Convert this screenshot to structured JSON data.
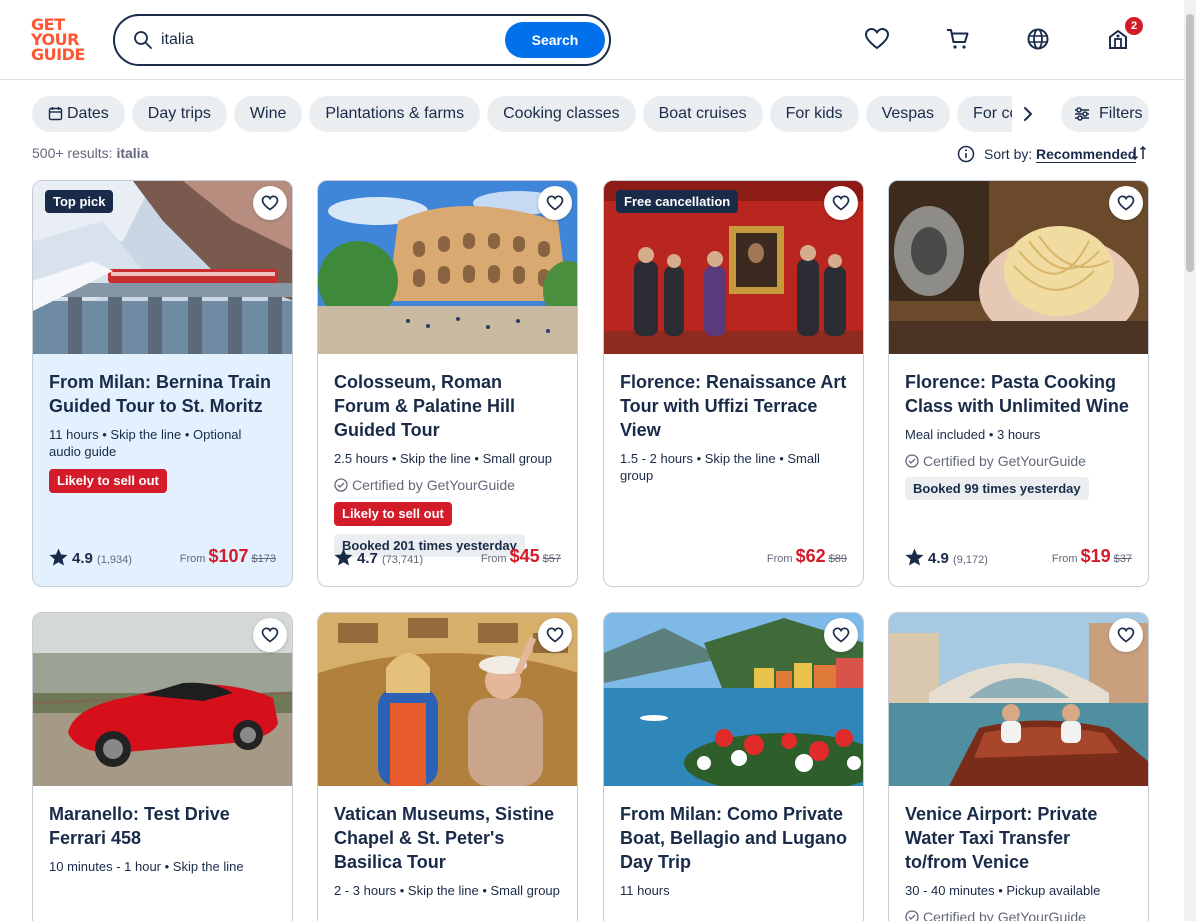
{
  "logo": {
    "line1": "GET",
    "line2": "YOUR",
    "line3": "GUIDE"
  },
  "search": {
    "value": "italia",
    "button": "Search"
  },
  "header": {
    "cart_badge": "2"
  },
  "chips": [
    "Dates",
    "Day trips",
    "Wine",
    "Plantations & farms",
    "Cooking classes",
    "Boat cruises",
    "For kids",
    "Vespas",
    "For couples"
  ],
  "filters_label": "Filters",
  "results": {
    "count": "500+ results:",
    "query": "italia"
  },
  "sort": {
    "label": "Sort by:",
    "value": "Recommended"
  },
  "cards": [
    {
      "tag": "Top pick",
      "title": "From Milan: Bernina Train Guided Tour to St. Moritz",
      "meta": "11 hours • Skip the line • Optional audio guide",
      "sell": "Likely to sell out",
      "rating": "4.9",
      "reviews": "(1,934)",
      "from": "From",
      "price": "$107",
      "old_price": "$173"
    },
    {
      "title": "Colosseum, Roman Forum & Palatine Hill Guided Tour",
      "meta": "2.5 hours • Skip the line • Small group",
      "cert": "Certified by GetYourGuide",
      "sell": "Likely to sell out",
      "booked": "Booked 201 times yesterday",
      "rating": "4.7",
      "reviews": "(73,741)",
      "from": "From",
      "price": "$45",
      "old_price": "$57"
    },
    {
      "tag": "Free cancellation",
      "title": "Florence: Renaissance Art Tour with Uffizi Terrace View",
      "meta": "1.5 - 2 hours • Skip the line • Small group",
      "from": "From",
      "price": "$62",
      "old_price": "$89"
    },
    {
      "title": "Florence: Pasta Cooking Class with Unlimited Wine",
      "meta": "Meal included • 3 hours",
      "cert": "Certified by GetYourGuide",
      "booked": "Booked 99 times yesterday",
      "rating": "4.9",
      "reviews": "(9,172)",
      "from": "From",
      "price": "$19",
      "old_price": "$37"
    },
    {
      "title": "Maranello: Test Drive Ferrari 458",
      "meta": "10 minutes - 1 hour • Skip the line"
    },
    {
      "title": "Vatican Museums, Sistine Chapel & St. Peter's Basilica Tour",
      "meta": "2 - 3 hours • Skip the line • Small group"
    },
    {
      "title": "From Milan: Como Private Boat, Bellagio and Lugano Day Trip",
      "meta": "11 hours"
    },
    {
      "title": "Venice Airport: Private Water Taxi Transfer to/from Venice",
      "meta": "30 - 40 minutes • Pickup available",
      "cert": "Certified by GetYourGuide"
    }
  ],
  "colors": {
    "brand": "#ff5533",
    "primary": "#0071eb",
    "price": "#d31b2a",
    "navy": "#1a2b49"
  }
}
